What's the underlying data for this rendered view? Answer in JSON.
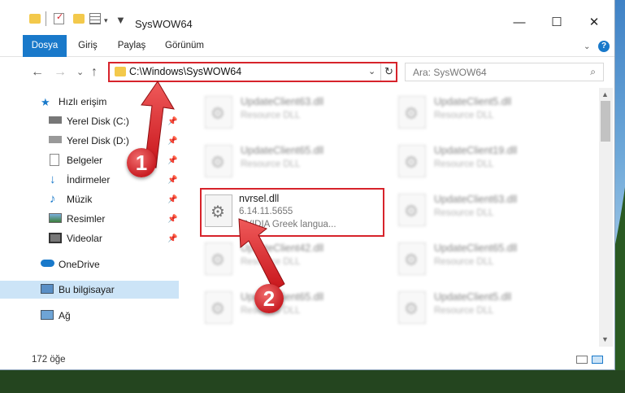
{
  "window": {
    "title": "SysWOW64",
    "minimize": "—",
    "maximize": "☐",
    "close": "✕"
  },
  "ribbon": {
    "tabs": [
      {
        "label": "Dosya",
        "active": true
      },
      {
        "label": "Giriş"
      },
      {
        "label": "Paylaş"
      },
      {
        "label": "Görünüm"
      }
    ],
    "help": "?"
  },
  "address": {
    "path": "C:\\Windows\\SysWOW64",
    "refresh": "↻",
    "dropdown": "⌄"
  },
  "search": {
    "placeholder": "Ara: SysWOW64",
    "icon": "search-icon"
  },
  "nav": {
    "back": "←",
    "forward": "→",
    "recent": "⌄",
    "up": "↑"
  },
  "sidebar": {
    "items": [
      {
        "label": "Hızlı erişim",
        "icon": "star-icon",
        "pinned": false
      },
      {
        "label": "Yerel Disk (C:)",
        "icon": "drive-icon",
        "pinned": true
      },
      {
        "label": "Yerel Disk (D:)",
        "icon": "drive-icon",
        "pinned": true
      },
      {
        "label": "Belgeler",
        "icon": "document-icon",
        "pinned": true
      },
      {
        "label": "İndirmeler",
        "icon": "download-icon",
        "pinned": true
      },
      {
        "label": "Müzik",
        "icon": "music-icon",
        "pinned": true
      },
      {
        "label": "Resimler",
        "icon": "picture-icon",
        "pinned": true
      },
      {
        "label": "Videolar",
        "icon": "video-icon",
        "pinned": true
      },
      {
        "label": "OneDrive",
        "icon": "cloud-icon",
        "pinned": false
      },
      {
        "label": "Bu bilgisayar",
        "icon": "computer-icon",
        "pinned": false,
        "selected": true
      },
      {
        "label": "Ağ",
        "icon": "network-icon",
        "pinned": false
      }
    ]
  },
  "files": {
    "blurred": [
      {
        "name": "UpdateClient63.dll",
        "desc": "Resource DLL"
      },
      {
        "name": "UpdateClient5.dll",
        "desc": "Resource DLL"
      },
      {
        "name": "UpdateClient65.dll",
        "desc": "Resource DLL"
      },
      {
        "name": "UpdateClient19.dll",
        "desc": "Resource DLL"
      },
      {
        "name": "UpdateClient63.dll",
        "desc": "Resource DLL"
      },
      {
        "name": "UpdateClient42.dll",
        "desc": "Resource DLL"
      },
      {
        "name": "UpdateClient65.dll",
        "desc": "Resource DLL"
      },
      {
        "name": "UpdateClient65.dll",
        "desc": "Resource DLL"
      },
      {
        "name": "UpdateClient5.dll",
        "desc": "Resource DLL"
      }
    ],
    "highlighted": {
      "name": "nvrsel.dll",
      "version": "6.14.11.5655",
      "desc": "NVIDIA Greek langua..."
    }
  },
  "status": {
    "count": "172 öğe"
  },
  "annotations": {
    "step1": "1",
    "step2": "2"
  },
  "colors": {
    "accent": "#1979ca",
    "highlight": "#d7232b",
    "selected": "#cce4f7"
  }
}
